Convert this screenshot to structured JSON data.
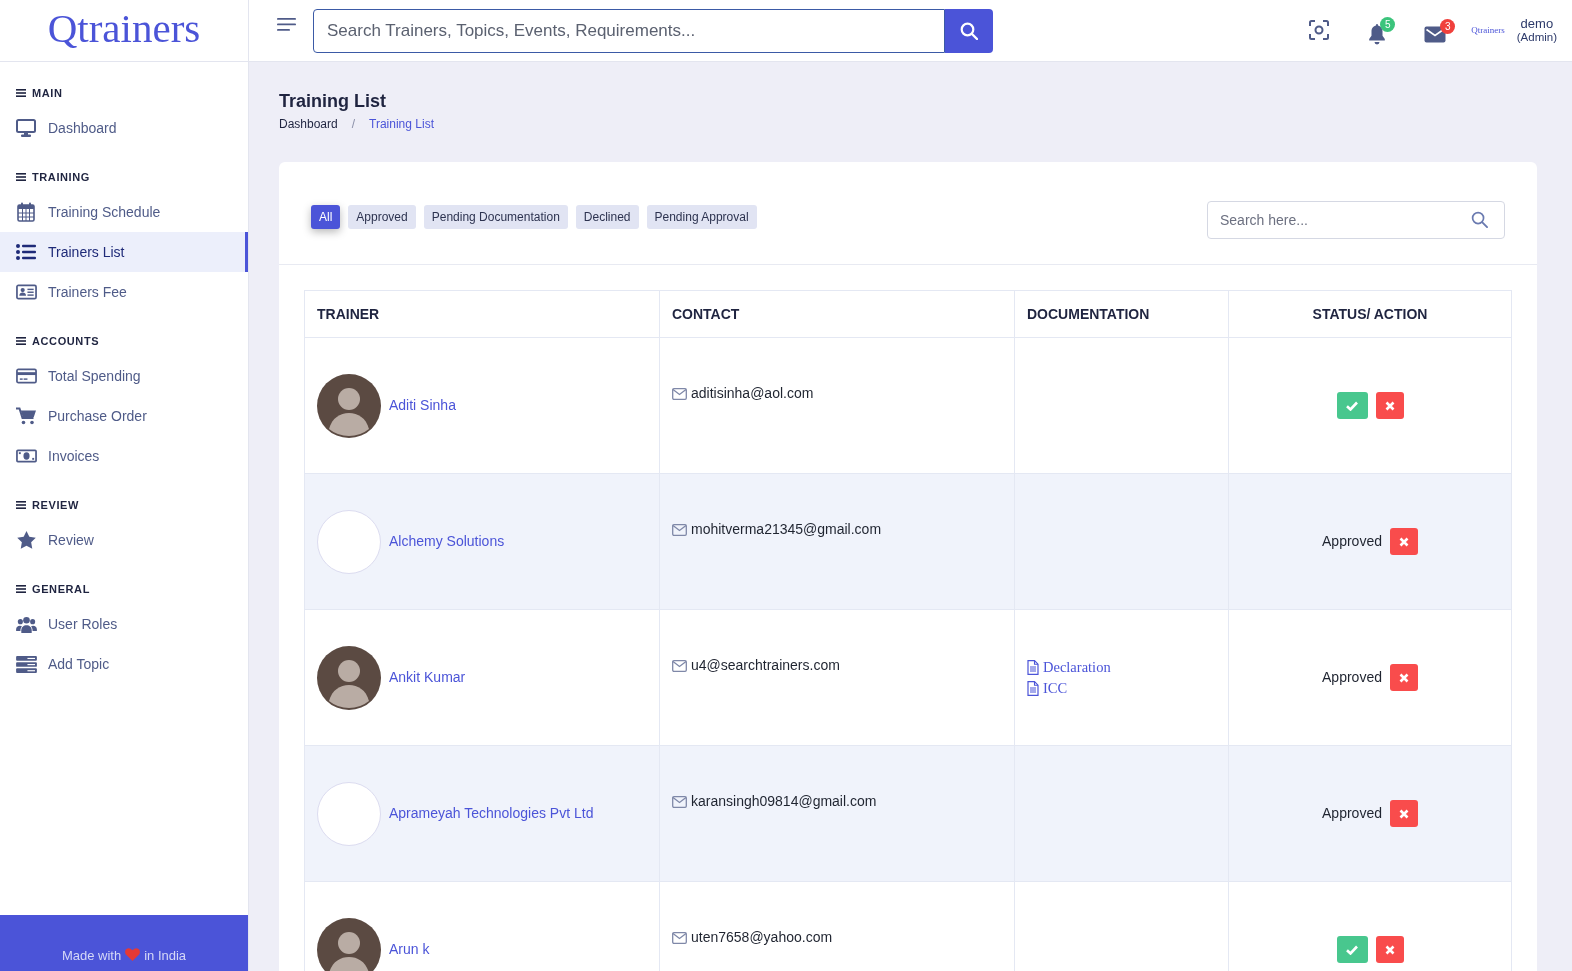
{
  "header": {
    "logo": "Qtrainers",
    "search": {
      "placeholder": "Search Trainers, Topics, Events, Requirements..."
    },
    "notifications": {
      "count": "5"
    },
    "messages": {
      "count": "3"
    },
    "user": {
      "logo": "Qtrainers",
      "name": "demo",
      "role": "(Admin)"
    }
  },
  "sidebar": {
    "sections": [
      {
        "title": "MAIN",
        "items": [
          {
            "label": "Dashboard",
            "selected": false
          }
        ]
      },
      {
        "title": "TRAINING",
        "items": [
          {
            "label": "Training Schedule",
            "selected": false
          },
          {
            "label": "Trainers List",
            "selected": true
          },
          {
            "label": "Trainers Fee",
            "selected": false
          }
        ]
      },
      {
        "title": "ACCOUNTS",
        "items": [
          {
            "label": "Total Spending",
            "selected": false
          },
          {
            "label": "Purchase Order",
            "selected": false
          },
          {
            "label": "Invoices",
            "selected": false
          }
        ]
      },
      {
        "title": "REVIEW",
        "items": [
          {
            "label": "Review",
            "selected": false
          }
        ]
      },
      {
        "title": "GENERAL",
        "items": [
          {
            "label": "User Roles",
            "selected": false
          },
          {
            "label": "Add Topic",
            "selected": false
          }
        ]
      }
    ],
    "footer": {
      "text_before": "Made with",
      "text_after": "in India"
    }
  },
  "page": {
    "title": "Training List",
    "breadcrumb": {
      "items": [
        "Dashboard",
        "Training List"
      ],
      "separator": "/"
    }
  },
  "filters": [
    {
      "label": "All",
      "selected": true
    },
    {
      "label": "Approved",
      "selected": false
    },
    {
      "label": "Pending Documentation",
      "selected": false
    },
    {
      "label": "Declined",
      "selected": false
    },
    {
      "label": "Pending Approval",
      "selected": false
    }
  ],
  "list_search": {
    "placeholder": "Search here..."
  },
  "table": {
    "columns": [
      "TRAINER",
      "CONTACT",
      "DOCUMENTATION",
      "STATUS/ ACTION"
    ],
    "rows": [
      {
        "trainer": "Aditi Sinha",
        "avatar": {
          "kind": "photo"
        },
        "email": "aditisinha@aol.com"
      },
      {
        "trainer": "Alchemy Solutions",
        "avatar": {
          "kind": "logo"
        },
        "email": "mohitverma21345@gmail.com",
        "status": "Approved"
      },
      {
        "trainer": "Ankit Kumar",
        "avatar": {
          "kind": "photo"
        },
        "email": "u4@searchtrainers.com",
        "documents": [
          "Declaration",
          "ICC"
        ],
        "status": "Approved"
      },
      {
        "trainer": "Aprameyah Technologies Pvt Ltd",
        "avatar": {
          "kind": "logo"
        },
        "email": "karansingh09814@gmail.com",
        "status": "Approved"
      },
      {
        "trainer": "Arun k",
        "avatar": {
          "kind": "photo"
        },
        "email": "uten7658@yahoo.com"
      }
    ]
  }
}
